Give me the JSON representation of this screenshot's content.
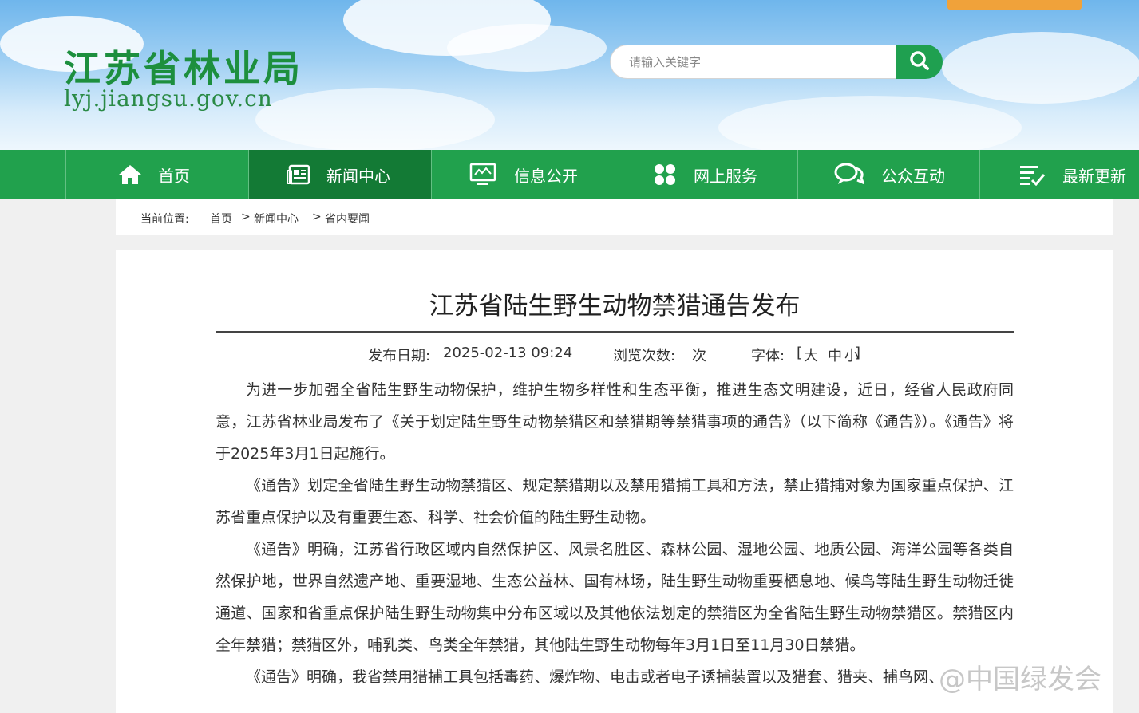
{
  "header": {
    "title_cn": "江苏省林业局",
    "domain": "lyj.jiangsu.gov.cn"
  },
  "search": {
    "placeholder": "请输入关键字"
  },
  "nav": {
    "items": [
      {
        "label": "首页",
        "icon": "home-icon"
      },
      {
        "label": "新闻中心",
        "icon": "newspaper-icon",
        "active": true
      },
      {
        "label": "信息公开",
        "icon": "monitor-icon"
      },
      {
        "label": "网上服务",
        "icon": "grid-icon"
      },
      {
        "label": "公众互动",
        "icon": "chat-icon"
      },
      {
        "label": "最新更新",
        "icon": "list-check-icon"
      }
    ]
  },
  "breadcrumb": {
    "prefix": "当前位置:",
    "items": [
      "首页",
      "新闻中心",
      "省内要闻"
    ],
    "separator": ">"
  },
  "article": {
    "title": "江苏省陆生野生动物禁猎通告发布",
    "date_label": "发布日期:",
    "date_value": "2025-02-13 09:24",
    "views_label": "浏览次数:",
    "views_unit": "次",
    "font_label": "字体:",
    "font_open": "[",
    "font_large": "大",
    "font_medium": "中",
    "font_small": "小",
    "font_close": "]",
    "paragraphs": [
      "为进一步加强全省陆生野生动物保护，维护生物多样性和生态平衡，推进生态文明建设，近日，经省人民政府同意，江苏省林业局发布了《关于划定陆生野生动物禁猎区和禁猎期等禁猎事项的通告》（以下简称《通告》）。《通告》将于2025年3月1日起施行。",
      "《通告》划定全省陆生野生动物禁猎区、规定禁猎期以及禁用猎捕工具和方法，禁止猎捕对象为国家重点保护、江苏省重点保护以及有重要生态、科学、社会价值的陆生野生动物。",
      "《通告》明确，江苏省行政区域内自然保护区、风景名胜区、森林公园、湿地公园、地质公园、海洋公园等各类自然保护地，世界自然遗产地、重要湿地、生态公益林、国有林场，陆生野生动物重要栖息地、候鸟等陆生野生动物迁徙通道、国家和省重点保护陆生野生动物集中分布区域以及其他依法划定的禁猎区为全省陆生野生动物禁猎区。禁猎区内全年禁猎；禁猎区外，哺乳类、鸟类全年禁猎，其他陆生野生动物每年3月1日至11月30日禁猎。",
      "《通告》明确，我省禁用猎捕工具包括毒药、爆炸物、电击或者电子诱捕装置以及猎套、猎夹、捕鸟网、"
    ]
  },
  "watermark": {
    "text": "@中国绿发会"
  },
  "colors": {
    "nav_green": "#21a14d",
    "nav_active": "#137a35",
    "logo_green": "#1d8f3e",
    "search_button": "#1fa050"
  }
}
